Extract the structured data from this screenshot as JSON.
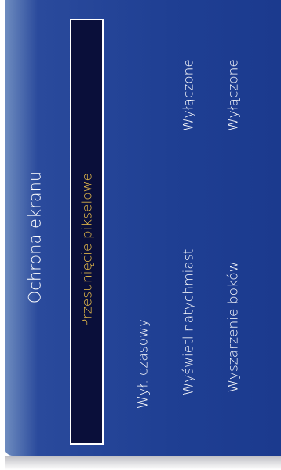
{
  "menu": {
    "title": "Ochrona ekranu",
    "items": [
      {
        "label": "Przesunięcie pikselowe",
        "value": "",
        "selected": true
      },
      {
        "label": "Wył. czasowy",
        "value": ""
      },
      {
        "label": "Wyświetl natychmiast",
        "value": "Wyłączone"
      },
      {
        "label": "Wyszarzenie boków",
        "value": "Wyłączone"
      }
    ]
  },
  "colors": {
    "panel": "#1f3f93",
    "selection_bg": "#0a0f3a",
    "selection_text": "#f2c44a",
    "text": "#ffffff"
  }
}
